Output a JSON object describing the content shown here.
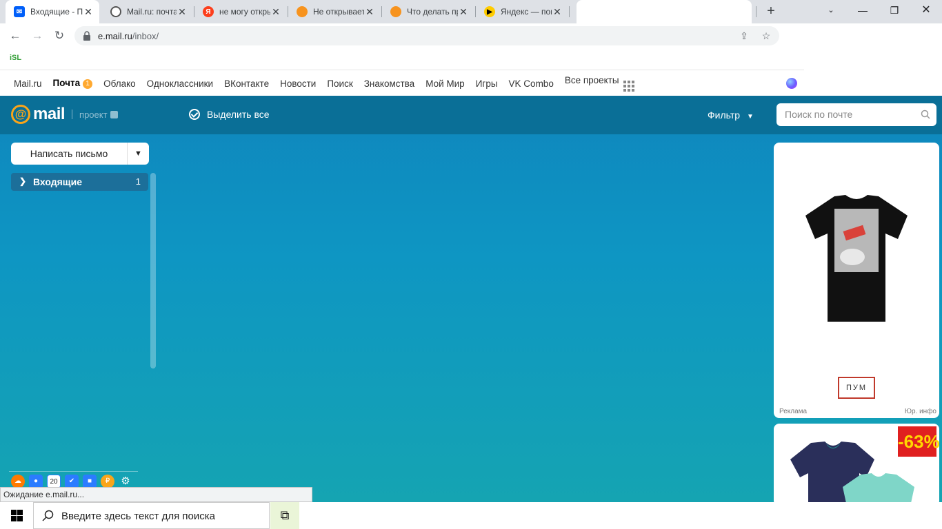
{
  "browser": {
    "tabs": [
      {
        "title": "Входящие - Почта Mail.ru",
        "favicon": "mail-favicon",
        "color": "#005ff9",
        "active": true
      },
      {
        "title": "Mail.ru: почта, поиск в интернете",
        "favicon": "mailru-favicon",
        "color": "#555555"
      },
      {
        "title": "не могу открыть почту",
        "favicon": "yandex-favicon",
        "color": "#fc3f1d"
      },
      {
        "title": "Не открывается почта",
        "favicon": "orange-favicon",
        "color": "#f7931e"
      },
      {
        "title": "Что делать при ошибке",
        "favicon": "orange-favicon",
        "color": "#f7931e"
      },
      {
        "title": "Яндекс — поиск",
        "favicon": "yandex-play-favicon",
        "color": "#ffcc00"
      },
      {
        "title": "",
        "favicon": "blank-favicon",
        "color": "#ffffff"
      }
    ],
    "url_host": "e.mail.ru",
    "url_path": "/inbox/",
    "bookmark": "iSL",
    "status": "Ожидание e.mail.ru..."
  },
  "portal": {
    "items": [
      "Mail.ru",
      "Почта",
      "Облако",
      "Одноклассники",
      "ВКонтакте",
      "Новости",
      "Поиск",
      "Знакомства",
      "Мой Мир",
      "Игры",
      "VK Combo",
      "Все проекты"
    ],
    "mail_badge": "1"
  },
  "mail": {
    "logo_text": "mail",
    "project_text": "проект",
    "select_all": "Выделить все",
    "filter": "Фильтр",
    "search_placeholder": "Поиск по почте",
    "compose": "Написать письмо",
    "folder_name": "Входящие",
    "folder_count": "1",
    "calendar_day": "20",
    "ad": {
      "label": "Реклама",
      "legal": "Юр. инфо",
      "brand": "ПУМ",
      "discount": "-63%"
    }
  },
  "taskbar": {
    "search_placeholder": "Введите здесь текст для поиска"
  },
  "colors": {
    "accent": "#0a6f97",
    "badge": "#ffa930",
    "folder": "#1c6f9a"
  }
}
